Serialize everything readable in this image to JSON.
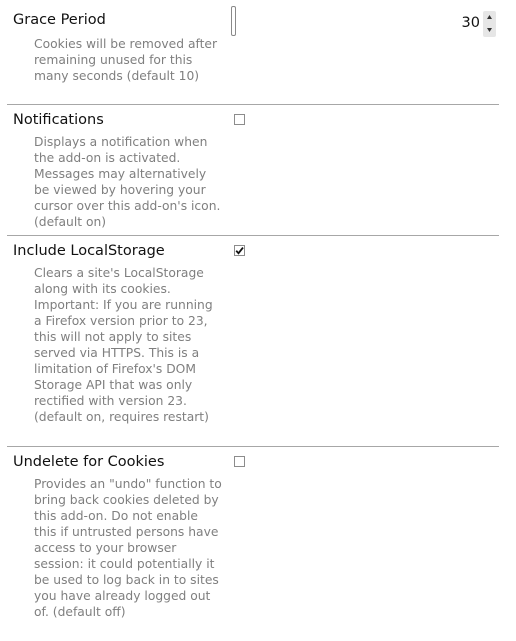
{
  "preferences": [
    {
      "title": "Grace Period",
      "description": "Cookies will be removed after remaining unused for this many seconds (default 10)",
      "control": "number",
      "value": "30",
      "spinner_icons": [
        "spinner-up-icon",
        "spinner-down-icon"
      ]
    },
    {
      "title": "Notifications",
      "description": "Displays a notification when the add-on is activated. Messages may alternatively be viewed by hovering your cursor over this add-on's icon. (default on)",
      "control": "checkbox",
      "checked": false
    },
    {
      "title": "Include LocalStorage",
      "description": "Clears a site's LocalStorage along with its cookies. Important: If you are running a Firefox version prior to 23, this will not apply to sites served via HTTPS. This is a limitation of Firefox's DOM Storage API that was only rectified with version 23. (default on, requires restart)",
      "control": "checkbox",
      "checked": true,
      "check_icon": "checkmark-icon"
    },
    {
      "title": "Undelete for Cookies",
      "description": "Provides an \"undo\" function to bring back cookies deleted by this add-on. Do not enable this if untrusted persons have access to your browser session: it could potentially it be used to log back in to sites you have already logged out of. (default off)",
      "control": "checkbox",
      "checked": false
    }
  ]
}
